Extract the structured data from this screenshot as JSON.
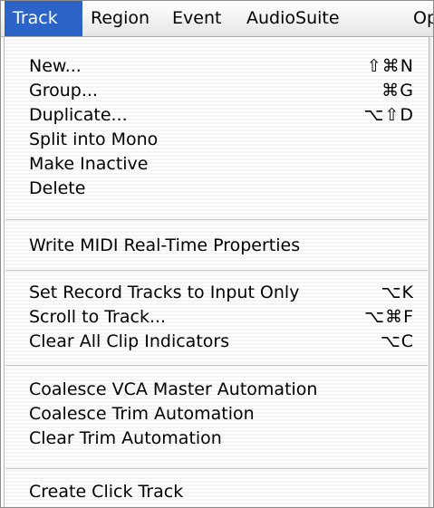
{
  "menubar": {
    "items": [
      {
        "label": "Track",
        "active": true
      },
      {
        "label": "Region"
      },
      {
        "label": "Event"
      },
      {
        "label": "AudioSuite"
      },
      {
        "label": "Op"
      }
    ]
  },
  "track_menu": {
    "groups": [
      [
        {
          "label": "New...",
          "shortcut": "⇧⌘N"
        },
        {
          "label": "Group...",
          "shortcut": "⌘G"
        },
        {
          "label": "Duplicate...",
          "shortcut": "⌥⇧D"
        },
        {
          "label": "Split into Mono",
          "shortcut": ""
        },
        {
          "label": "Make Inactive",
          "shortcut": ""
        },
        {
          "label": "Delete",
          "shortcut": ""
        }
      ],
      [
        {
          "label": "Write MIDI Real-Time Properties",
          "shortcut": ""
        }
      ],
      [
        {
          "label": "Set Record Tracks to Input Only",
          "shortcut": "⌥K"
        },
        {
          "label": "Scroll to Track...",
          "shortcut": "⌥⌘F"
        },
        {
          "label": "Clear All Clip Indicators",
          "shortcut": "⌥C"
        }
      ],
      [
        {
          "label": "Coalesce VCA Master Automation",
          "shortcut": ""
        },
        {
          "label": "Coalesce Trim Automation",
          "shortcut": ""
        },
        {
          "label": "Clear Trim Automation",
          "shortcut": ""
        }
      ],
      [
        {
          "label": "Create Click Track",
          "shortcut": ""
        }
      ]
    ]
  },
  "colors": {
    "highlight": "#2c63c7",
    "highlight_text": "#ffffff",
    "menu_text": "#000000",
    "separator": "#c6c6c6"
  }
}
